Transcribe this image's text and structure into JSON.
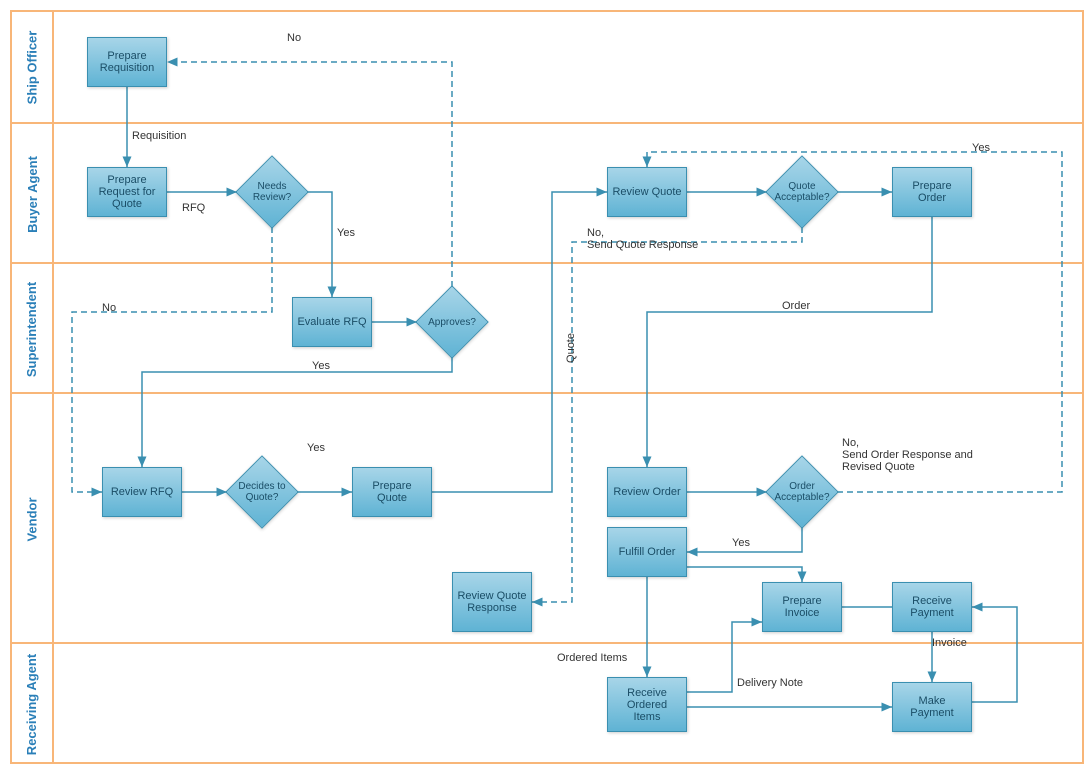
{
  "lanes": {
    "ship_officer": "Ship Officer",
    "buyer_agent": "Buyer Agent",
    "superintendent": "Superintendent",
    "vendor": "Vendor",
    "receiving_agent": "Receiving Agent"
  },
  "boxes": {
    "prepare_requisition": "Prepare Requisition",
    "prepare_rfq": "Prepare Request for Quote",
    "evaluate_rfq": "Evaluate RFQ",
    "review_rfq": "Review RFQ",
    "prepare_quote": "Prepare Quote",
    "review_quote_response": "Review Quote Response",
    "review_quote": "Review Quote",
    "prepare_order": "Prepare Order",
    "review_order": "Review Order",
    "fulfill_order": "Fulfill Order",
    "prepare_invoice": "Prepare Invoice",
    "receive_payment": "Receive Payment",
    "receive_ordered_items": "Receive Ordered Items",
    "make_payment": "Make Payment"
  },
  "decisions": {
    "needs_review": "Needs Review?",
    "approves": "Approves?",
    "decides_quote": "Decides to Quote?",
    "quote_acceptable": "Quote Acceptable?",
    "order_acceptable": "Order Acceptable?"
  },
  "labels": {
    "no": "No",
    "yes": "Yes",
    "requisition": "Requisition",
    "rfq": "RFQ",
    "quote": "Quote",
    "order": "Order",
    "no_send_quote": "No,\nSend Quote Response",
    "no_send_order": "No,\nSend Order Response and\nRevised Quote",
    "ordered_items": "Ordered Items",
    "delivery_note": "Delivery Note",
    "invoice": "Invoice"
  }
}
